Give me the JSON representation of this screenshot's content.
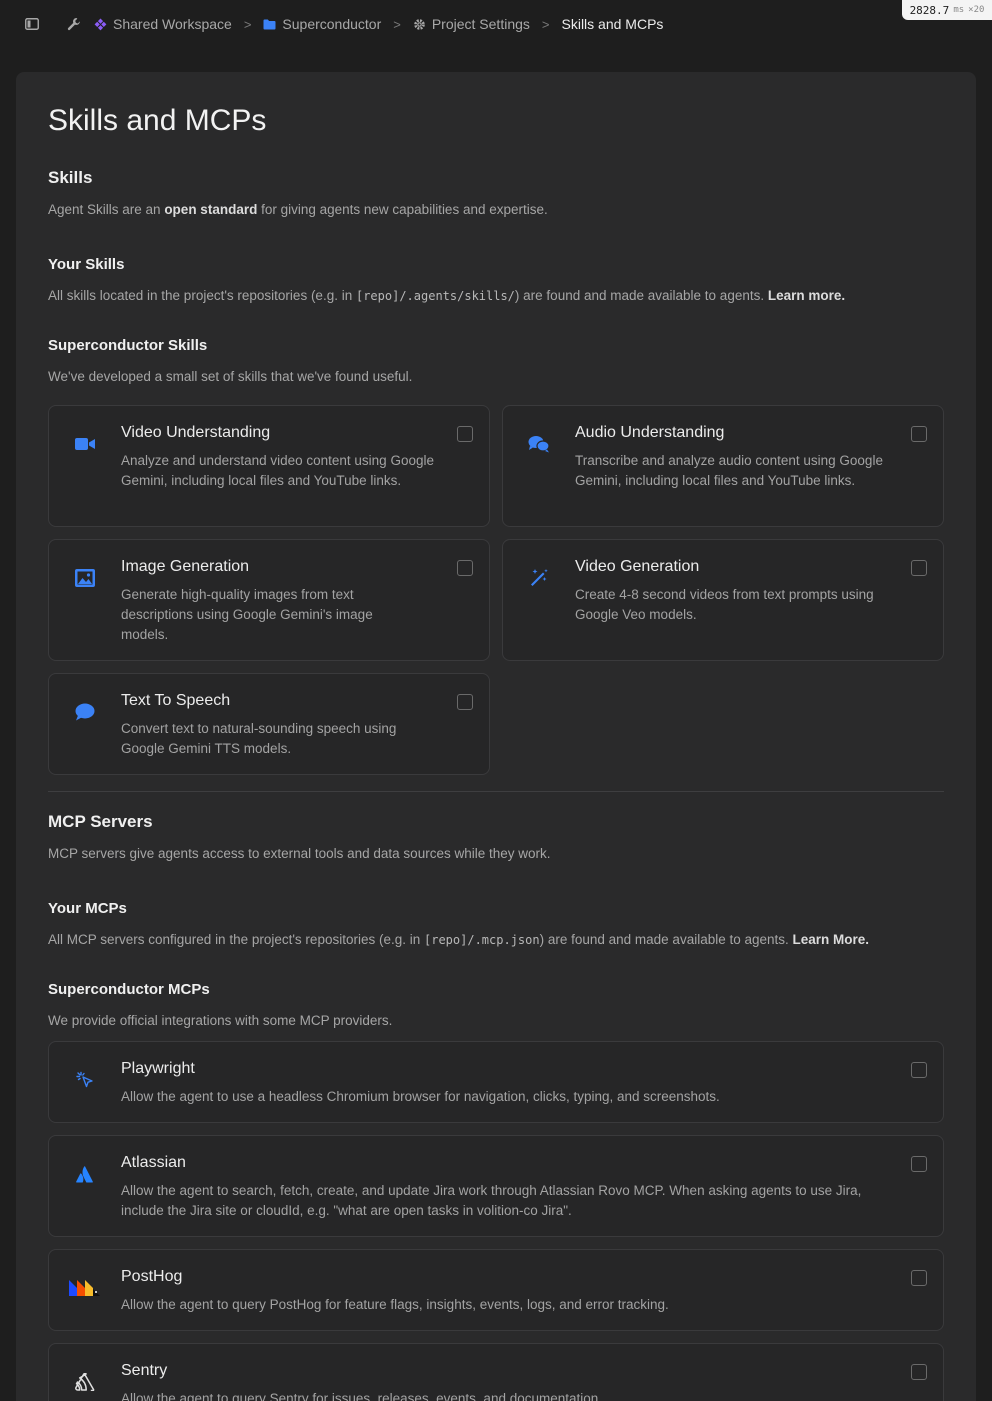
{
  "breadcrumb": {
    "workspace": "Shared Workspace",
    "project": "Superconductor",
    "settings": "Project Settings",
    "current": "Skills and MCPs"
  },
  "perf": {
    "value": "2828.7",
    "unit": "ms",
    "mult": "×20"
  },
  "page": {
    "title": "Skills and MCPs"
  },
  "skills": {
    "heading": "Skills",
    "desc_pre": "Agent Skills are an ",
    "desc_bold": "open standard",
    "desc_post": " for giving agents new capabilities and expertise.",
    "your": {
      "heading": "Your Skills",
      "desc_pre": "All skills located in the project's repositories (e.g. in ",
      "desc_code": "[repo]/.agents/skills/",
      "desc_post": ") are found and made available to agents. ",
      "learn": "Learn more."
    },
    "sc": {
      "heading": "Superconductor Skills",
      "desc": "We've developed a small set of skills that we've found useful."
    },
    "items": [
      {
        "title": "Video Understanding",
        "desc": "Analyze and understand video content using Google Gemini, including local files and YouTube links.",
        "icon": "video-camera-icon"
      },
      {
        "title": "Audio Understanding",
        "desc": "Transcribe and analyze audio content using Google Gemini, including local files and YouTube links.",
        "icon": "chat-bubbles-icon"
      },
      {
        "title": "Image Generation",
        "desc": "Generate high-quality images from text descriptions using Google Gemini's image models.",
        "icon": "image-icon"
      },
      {
        "title": "Video Generation",
        "desc": "Create 4-8 second videos from text prompts using Google Veo models.",
        "icon": "magic-wand-icon"
      },
      {
        "title": "Text To Speech",
        "desc": "Convert text to natural-sounding speech using Google Gemini TTS models.",
        "icon": "speech-bubble-icon"
      }
    ]
  },
  "mcp": {
    "heading": "MCP Servers",
    "desc": "MCP servers give agents access to external tools and data sources while they work.",
    "your": {
      "heading": "Your MCPs",
      "desc_pre": "All MCP servers configured in the project's repositories (e.g. in ",
      "desc_code": "[repo]/.mcp.json",
      "desc_post": ") are found and made available to agents. ",
      "learn": "Learn More."
    },
    "sc": {
      "heading": "Superconductor MCPs",
      "desc": "We provide official integrations with some MCP providers."
    },
    "items": [
      {
        "title": "Playwright",
        "desc": "Allow the agent to use a headless Chromium browser for navigation, clicks, typing, and screenshots.",
        "icon": "pointer-click-icon"
      },
      {
        "title": "Atlassian",
        "desc": "Allow the agent to search, fetch, create, and update Jira work through Atlassian Rovo MCP. When asking agents to use Jira, include the Jira site or cloudId, e.g. \"what are open tasks in volition-co Jira\".",
        "icon": "atlassian-logo-icon"
      },
      {
        "title": "PostHog",
        "desc": "Allow the agent to query PostHog for feature flags, insights, events, logs, and error tracking.",
        "icon": "posthog-logo-icon"
      },
      {
        "title": "Sentry",
        "desc": "Allow the agent to query Sentry for issues, releases, events, and documentation.",
        "icon": "sentry-logo-icon"
      }
    ]
  },
  "colors": {
    "accent": "#3b82f6",
    "workspace_icon": "#8b5cf6"
  }
}
